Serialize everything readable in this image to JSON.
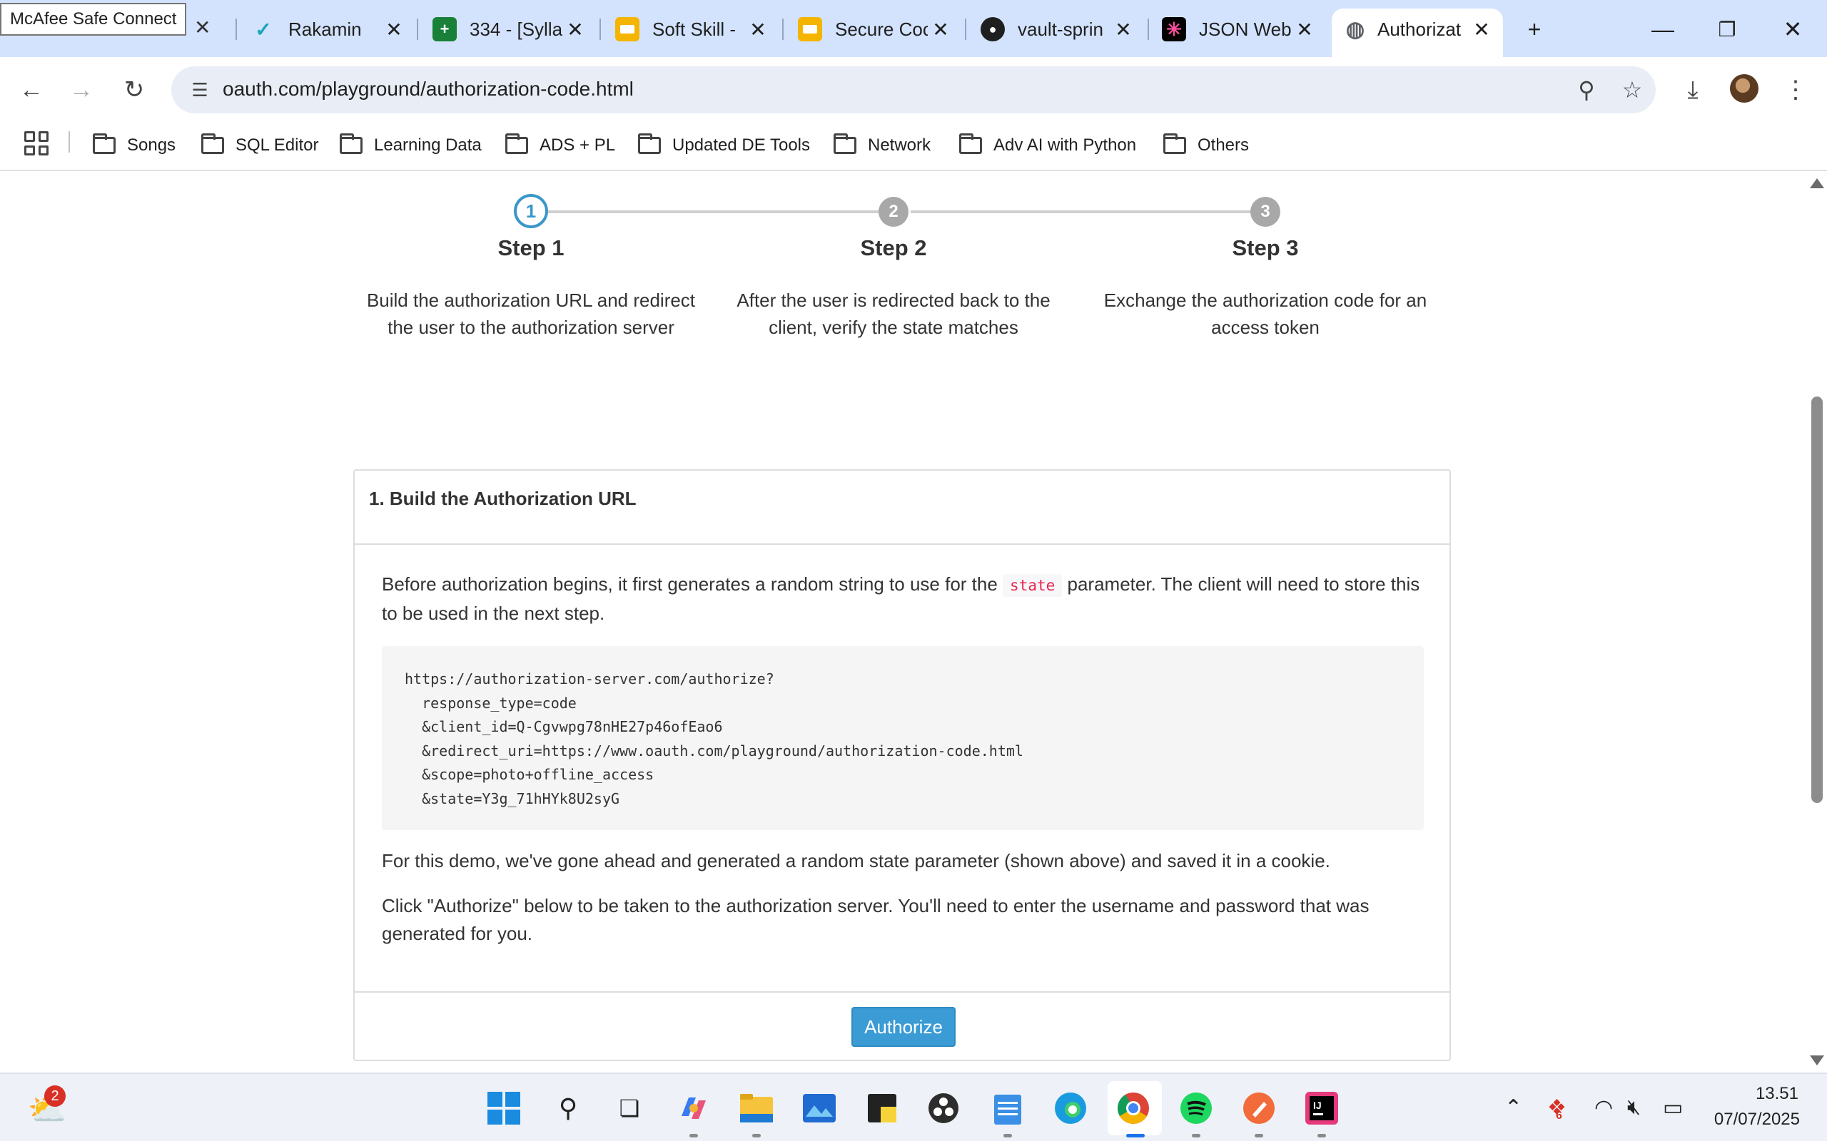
{
  "browser": {
    "tooltip": "McAfee Safe Connect",
    "tabs": [
      {
        "title": "Rakamin",
        "favicon": "rakamin-icon",
        "color": "#1aa7b8"
      },
      {
        "title": "334 - [Sylla",
        "favicon": "sheets-icon",
        "color": "#188038"
      },
      {
        "title": "Soft Skill -",
        "favicon": "slides-icon",
        "color": "#f4b400"
      },
      {
        "title": "Secure Coc",
        "favicon": "slides-icon",
        "color": "#f4b400"
      },
      {
        "title": "vault-sprin",
        "favicon": "github-icon",
        "color": "#1f1f1f"
      },
      {
        "title": "JSON Web",
        "favicon": "jwt-icon",
        "color": "#000000"
      },
      {
        "title": "Authorizat",
        "favicon": "globe-icon",
        "color": "#5f6368",
        "active": true
      }
    ],
    "url": "oauth.com/playground/authorization-code.html",
    "bookmarks": [
      "Songs",
      "SQL Editor",
      "Learning Data",
      "ADS + PL",
      "Updated DE Tools",
      "Network",
      "Adv AI with Python",
      "Others"
    ]
  },
  "page": {
    "steps": [
      {
        "number": "1",
        "title": "Step 1",
        "description": "Build the authorization URL and redirect the user to the authorization server",
        "state": "active"
      },
      {
        "number": "2",
        "title": "Step 2",
        "description": "After the user is redirected back to the client, verify the state matches",
        "state": "todo"
      },
      {
        "number": "3",
        "title": "Step 3",
        "description": "Exchange the authorization code for an access token",
        "state": "todo"
      }
    ],
    "panel": {
      "title": "1. Build the Authorization URL",
      "intro_before": "Before authorization begins, it first generates a random string to use for the",
      "intro_code": "state",
      "intro_after": "parameter. The client will need to store this to be used in the next step.",
      "code": "https://authorization-server.com/authorize?\n  response_type=code\n  &client_id=Q-Cgvwpg78nHE27p46ofEao6\n  &redirect_uri=https://www.oauth.com/playground/authorization-code.html\n  &scope=photo+offline_access\n  &state=Y3g_71hHYk8U2syG",
      "demo_note": "For this demo, we've gone ahead and generated a random state parameter (shown above) and saved it in a cookie.",
      "click_note": "Click \"Authorize\" below to be taken to the authorization server. You'll need to enter the username and password that was generated for you.",
      "button": "Authorize"
    }
  },
  "taskbar": {
    "weather_badge": "2",
    "clock_time": "13.51",
    "clock_date": "07/07/2025",
    "apps": [
      "windows-start-icon",
      "search-icon",
      "task-view-icon",
      "copilot-icon",
      "file-explorer-icon",
      "photos-icon",
      "sticky-notes-icon",
      "obs-icon",
      "notepad-icon",
      "edge-icon",
      "chrome-icon",
      "spotify-icon",
      "pen-app-icon",
      "intellij-icon"
    ],
    "tray_badge": "6"
  },
  "colors": {
    "accent": "#3a96c9",
    "button": "#3a9bd5",
    "inline_code": "#e8244f",
    "tabstrip": "#d3e3fd"
  }
}
